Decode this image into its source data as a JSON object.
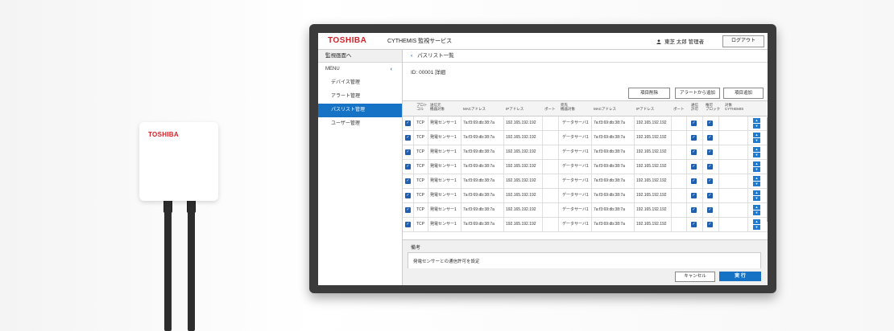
{
  "device": {
    "brand": "TOSHIBA"
  },
  "header": {
    "brand": "TOSHIBA",
    "app_name": "CYTHEMIS 監視サービス",
    "user": "東芝 太郎 管理者",
    "logout": "ログアウト"
  },
  "sidebar": {
    "top_link": "監視画面へ",
    "menu_label": "MENU",
    "items": [
      {
        "label": "デバイス管理"
      },
      {
        "label": "アラート管理"
      },
      {
        "label": "パスリスト管理"
      },
      {
        "label": "ユーザー管理"
      }
    ]
  },
  "page": {
    "back_title": "パスリスト一覧",
    "id_line": "ID: 00001 詳細"
  },
  "actions": {
    "delete": "項目削除",
    "add_from_alert": "アラートから追加",
    "add": "項目追加"
  },
  "table": {
    "headers": {
      "proto": "プロト\nコル",
      "src_target": "送信元\n機器対象",
      "mac1": "MACアドレス",
      "ip1": "IPアドレス",
      "port1": "ポート",
      "dst_target": "宛先\n機器対象",
      "mac2": "MACアドレス",
      "ip2": "IPアドレス",
      "port2": "ポート",
      "allow": "通信\n許可",
      "block": "権可\nブロック",
      "target": "対象\nCYTHEMIS"
    },
    "rows": [
      {
        "proto": "TCP",
        "src": "発電センサー1",
        "mac1": "7a:f3:69:db:38:7a",
        "ip1": "192.165.192.192",
        "port1": "",
        "dst": "データサーバ1",
        "mac2": "7a:f3:69:db:38:7a",
        "ip2": "192.165.192.192",
        "port2": ""
      },
      {
        "proto": "TCP",
        "src": "発電センサー1",
        "mac1": "7a:f3:69:db:38:7a",
        "ip1": "192.165.192.192",
        "port1": "",
        "dst": "データサーバ1",
        "mac2": "7a:f3:69:db:38:7a",
        "ip2": "192.165.192.192",
        "port2": ""
      },
      {
        "proto": "TCP",
        "src": "発電センサー1",
        "mac1": "7a:f3:69:db:38:7a",
        "ip1": "192.165.192.192",
        "port1": "",
        "dst": "データサーバ1",
        "mac2": "7a:f3:69:db:38:7a",
        "ip2": "192.165.192.192",
        "port2": ""
      },
      {
        "proto": "TCP",
        "src": "発電センサー1",
        "mac1": "7a:f3:69:db:38:7a",
        "ip1": "192.165.192.192",
        "port1": "",
        "dst": "データサーバ1",
        "mac2": "7a:f3:69:db:38:7a",
        "ip2": "192.165.192.192",
        "port2": ""
      },
      {
        "proto": "TCP",
        "src": "発電センサー1",
        "mac1": "7a:f3:69:db:38:7a",
        "ip1": "192.165.192.192",
        "port1": "",
        "dst": "データサーバ1",
        "mac2": "7a:f3:69:db:38:7a",
        "ip2": "192.165.192.192",
        "port2": ""
      },
      {
        "proto": "TCP",
        "src": "発電センサー1",
        "mac1": "7a:f3:69:db:38:7a",
        "ip1": "192.165.192.192",
        "port1": "",
        "dst": "データサーバ1",
        "mac2": "7a:f3:69:db:38:7a",
        "ip2": "192.165.192.192",
        "port2": ""
      },
      {
        "proto": "TCP",
        "src": "発電センサー1",
        "mac1": "7a:f3:69:db:38:7a",
        "ip1": "192.165.192.192",
        "port1": "",
        "dst": "データサーバ1",
        "mac2": "7a:f3:69:db:38:7a",
        "ip2": "192.165.192.192",
        "port2": ""
      },
      {
        "proto": "TCP",
        "src": "発電センサー1",
        "mac1": "7a:f3:69:db:38:7a",
        "ip1": "192.165.192.192",
        "port1": "",
        "dst": "データサーバ1",
        "mac2": "7a:f3:69:db:38:7a",
        "ip2": "192.165.192.192",
        "port2": ""
      }
    ]
  },
  "notes": {
    "label": "備考",
    "text": "発電センサーとの通信許可を設定"
  },
  "footer": {
    "cancel": "キャンセル",
    "execute": "実 行"
  },
  "colors": {
    "brand": "#d51f26",
    "accent": "#1672c4"
  },
  "icons": {
    "user": "user-icon",
    "back": "chevron-left-icon",
    "menu_collapse": "chevron-left-icon",
    "checkbox": "checkbox-checked-icon",
    "move": "move-up-down-icon"
  }
}
